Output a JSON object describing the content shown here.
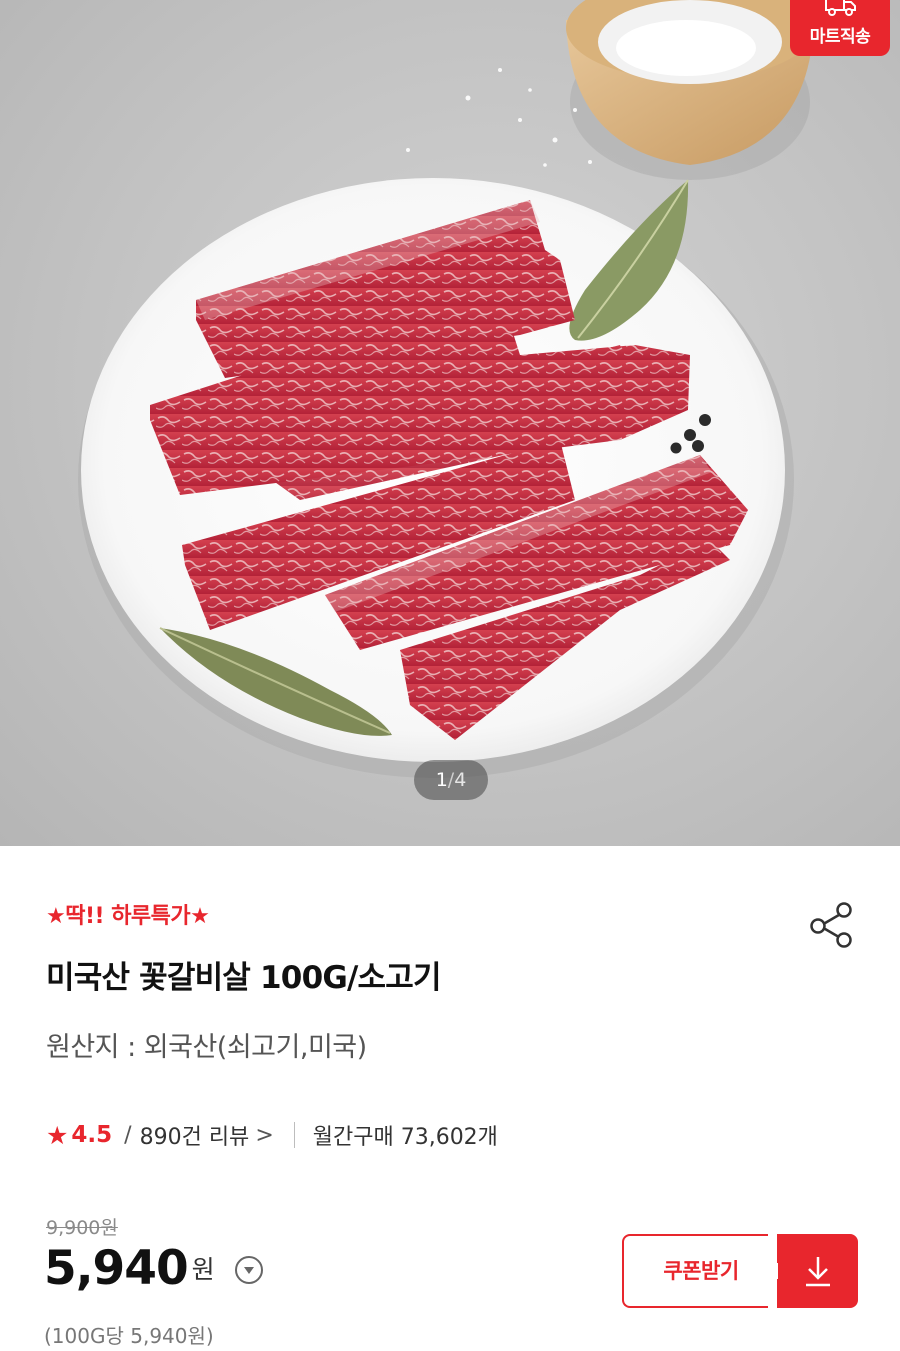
{
  "hero": {
    "badge_label": "마트직송",
    "pager": {
      "current": "1",
      "separator": "/",
      "total": "4"
    }
  },
  "product": {
    "promo_label": "★딱!! 하루특가★",
    "title": "미국산 꽃갈비살 100G/소고기",
    "origin": "원산지 : 외국산(쇠고기,미국)",
    "rating": {
      "score": "4.5",
      "separator": "/",
      "reviews": "890건 리뷰",
      "review_chevron": ">",
      "monthly_purchases": "월간구매 73,602개"
    },
    "price": {
      "original": "9,900원",
      "current": "5,940",
      "currency": "원",
      "unit_price": "(100G당 5,940원)"
    },
    "coupon_label": "쿠폰받기"
  },
  "colors": {
    "accent": "#e8262d"
  },
  "icons": {
    "badge": "delivery-truck-icon",
    "share": "share-icon",
    "rating": "star-icon",
    "price_toggle": "chevron-down-circle-icon",
    "coupon": "download-icon"
  }
}
